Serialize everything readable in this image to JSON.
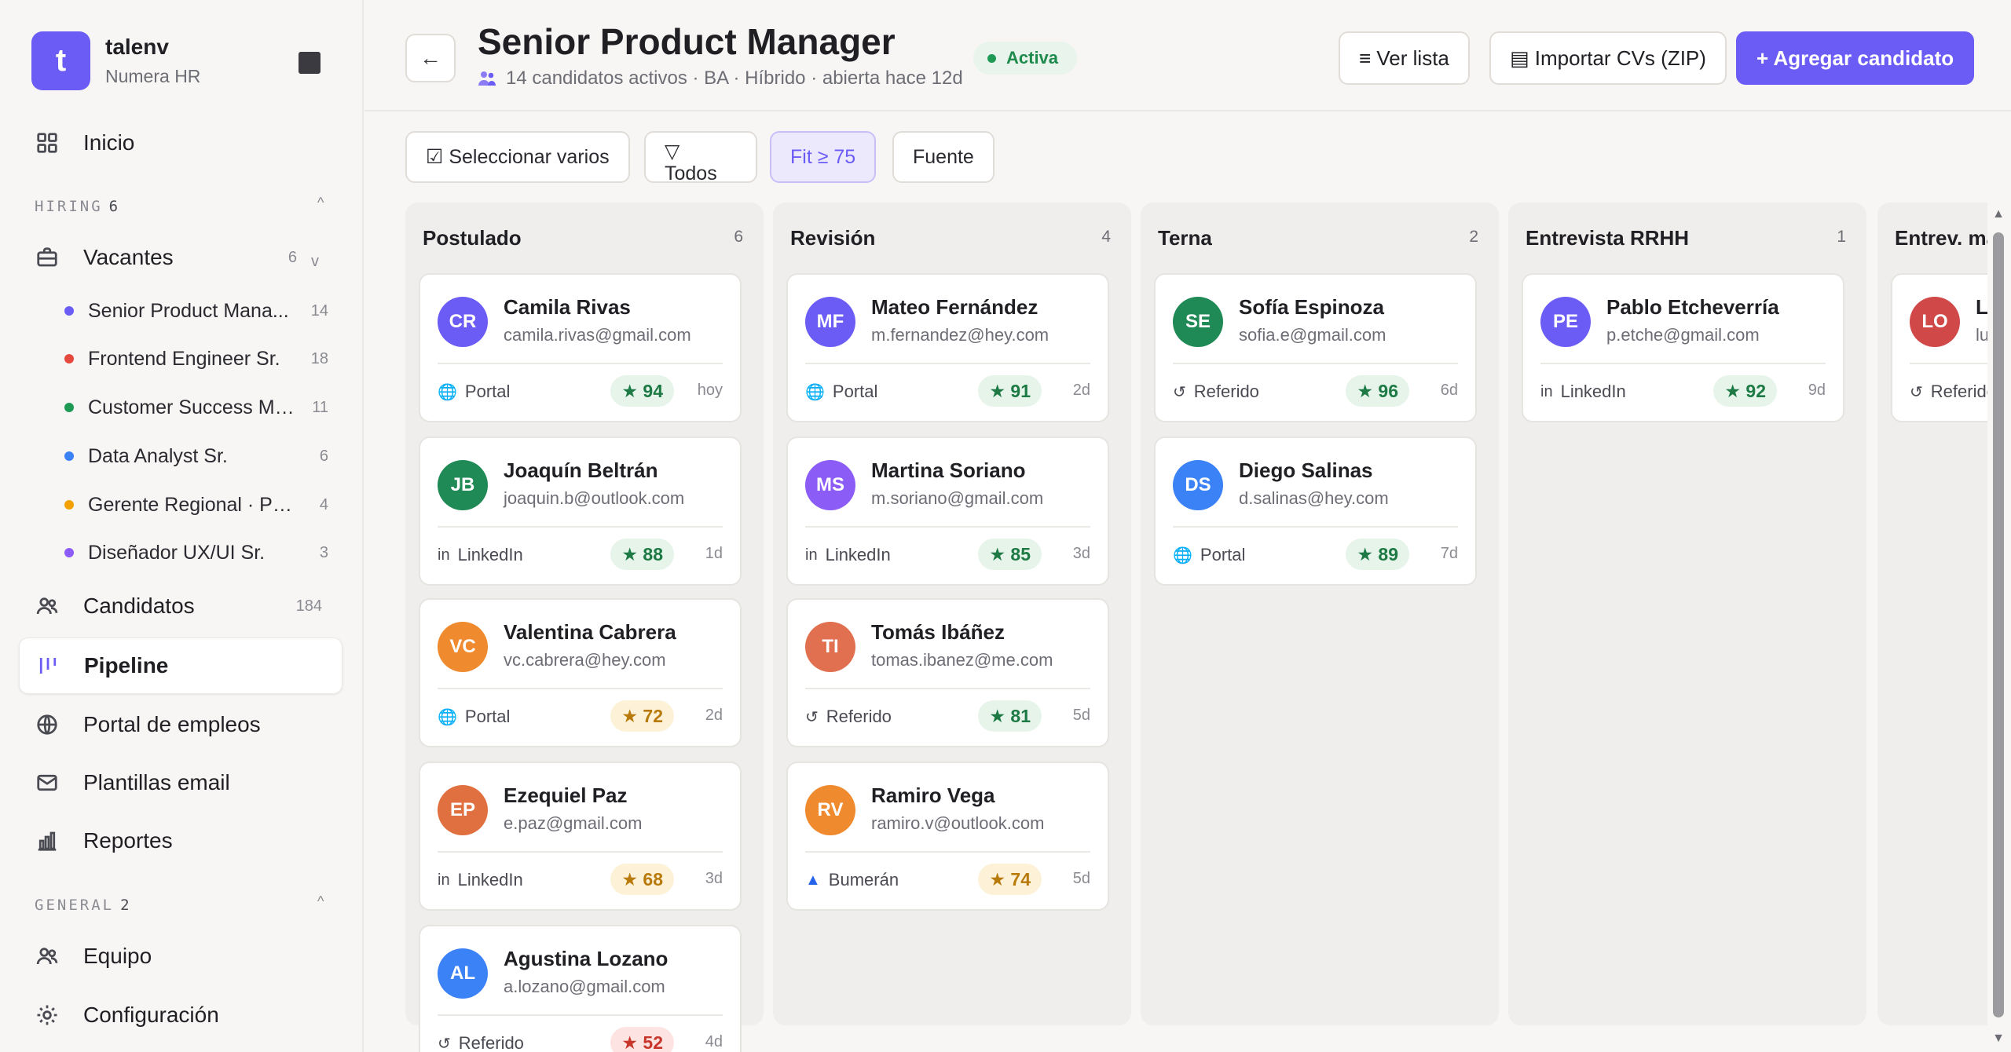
{
  "sidebar": {
    "brand_letter": "t",
    "brand_name": "talenv",
    "brand_sub": "Numera HR",
    "inicio": "Inicio",
    "hiring_label": "HIRING",
    "hiring_count": "6",
    "caret_up": "^",
    "vacantes": "Vacantes",
    "vacantes_count": "6",
    "vacantes_caret": "v",
    "vacancies": [
      {
        "label": "Senior Product Mana...",
        "count": "14",
        "color": "#6b5cf6"
      },
      {
        "label": "Frontend Engineer Sr.",
        "count": "18",
        "color": "#e5493e"
      },
      {
        "label": "Customer Success Mgr.",
        "count": "11",
        "color": "#1e9a55"
      },
      {
        "label": "Data Analyst Sr.",
        "count": "6",
        "color": "#3b82f6"
      },
      {
        "label": "Gerente Regional · Pre...",
        "count": "4",
        "color": "#f2a100"
      },
      {
        "label": "Diseñador UX/UI Sr.",
        "count": "3",
        "color": "#8b5cf6"
      }
    ],
    "candidatos": "Candidatos",
    "candidatos_count": "184",
    "pipeline": "Pipeline",
    "portal": "Portal de empleos",
    "plantillas": "Plantillas email",
    "reportes": "Reportes",
    "general_label": "GENERAL",
    "general_count": "2",
    "equipo": "Equipo",
    "configuracion": "Configuración"
  },
  "header": {
    "back": "←",
    "title": "Senior Product Manager",
    "status": "Activa",
    "subtitle": "14 candidatos activos · BA · Híbrido · abierta hace 12d",
    "ver_lista": "≡ Ver lista",
    "importar": "▤ Importar CVs (ZIP)",
    "agregar": "+ Agregar candidato"
  },
  "filters": {
    "seleccionar": "☑ Seleccionar varios",
    "todos": "▽ Todos",
    "fit": "Fit ≥ 75",
    "fuente": "Fuente"
  },
  "columns": [
    {
      "title": "Postulado",
      "count": "6",
      "cards": [
        {
          "initials": "CR",
          "color": "#6b5cf6",
          "name": "Camila Rivas",
          "email": "camila.rivas@gmail.com",
          "source_icon": "globe",
          "source": "Portal",
          "score": "★ 94",
          "tone": "g",
          "ago": "hoy"
        },
        {
          "initials": "JB",
          "color": "#1f8a55",
          "name": "Joaquín Beltrán",
          "email": "joaquin.b@outlook.com",
          "source_icon": "in",
          "source": "LinkedIn",
          "score": "★ 88",
          "tone": "g",
          "ago": "1d"
        },
        {
          "initials": "VC",
          "color": "#f08a2e",
          "name": "Valentina Cabrera",
          "email": "vc.cabrera@hey.com",
          "source_icon": "globe",
          "source": "Portal",
          "score": "★ 72",
          "tone": "y",
          "ago": "2d"
        },
        {
          "initials": "EP",
          "color": "#e07040",
          "name": "Ezequiel Paz",
          "email": "e.paz@gmail.com",
          "source_icon": "in",
          "source": "LinkedIn",
          "score": "★ 68",
          "tone": "y",
          "ago": "3d"
        },
        {
          "initials": "AL",
          "color": "#3b82f6",
          "name": "Agustina Lozano",
          "email": "a.lozano@gmail.com",
          "source_icon": "ref",
          "source": "Referido",
          "score": "★ 52",
          "tone": "r",
          "ago": "4d"
        }
      ]
    },
    {
      "title": "Revisión",
      "count": "4",
      "cards": [
        {
          "initials": "MF",
          "color": "#6b5cf6",
          "name": "Mateo Fernández",
          "email": "m.fernandez@hey.com",
          "source_icon": "globe",
          "source": "Portal",
          "score": "★ 91",
          "tone": "g",
          "ago": "2d"
        },
        {
          "initials": "MS",
          "color": "#8b5cf6",
          "name": "Martina Soriano",
          "email": "m.soriano@gmail.com",
          "source_icon": "in",
          "source": "LinkedIn",
          "score": "★ 85",
          "tone": "g",
          "ago": "3d"
        },
        {
          "initials": "TI",
          "color": "#e07050",
          "name": "Tomás Ibáñez",
          "email": "tomas.ibanez@me.com",
          "source_icon": "ref",
          "source": "Referido",
          "score": "★ 81",
          "tone": "g",
          "ago": "5d"
        },
        {
          "initials": "RV",
          "color": "#f08a2e",
          "name": "Ramiro Vega",
          "email": "ramiro.v@outlook.com",
          "source_icon": "bum",
          "source": "Bumerán",
          "score": "★ 74",
          "tone": "y",
          "ago": "5d"
        }
      ]
    },
    {
      "title": "Terna",
      "count": "2",
      "cards": [
        {
          "initials": "SE",
          "color": "#1f8a55",
          "name": "Sofía Espinoza",
          "email": "sofia.e@gmail.com",
          "source_icon": "ref",
          "source": "Referido",
          "score": "★ 96",
          "tone": "g",
          "ago": "6d"
        },
        {
          "initials": "DS",
          "color": "#3b82f6",
          "name": "Diego Salinas",
          "email": "d.salinas@hey.com",
          "source_icon": "globe",
          "source": "Portal",
          "score": "★ 89",
          "tone": "g",
          "ago": "7d"
        }
      ]
    },
    {
      "title": "Entrevista RRHH",
      "count": "1",
      "cards": [
        {
          "initials": "PE",
          "color": "#6b5cf6",
          "name": "Pablo Etcheverría",
          "email": "p.etche@gmail.com",
          "source_icon": "in",
          "source": "LinkedIn",
          "score": "★ 92",
          "tone": "g",
          "ago": "9d"
        }
      ]
    }
  ],
  "partial_column": {
    "title": "Entrev. ma",
    "card": {
      "initials": "LO",
      "color": "#d04848",
      "name": "Lu",
      "email": "lu.",
      "source": "Referido"
    }
  },
  "icons": {
    "globe": "🌐",
    "in": "in",
    "ref": "↺",
    "bum": "▲"
  }
}
